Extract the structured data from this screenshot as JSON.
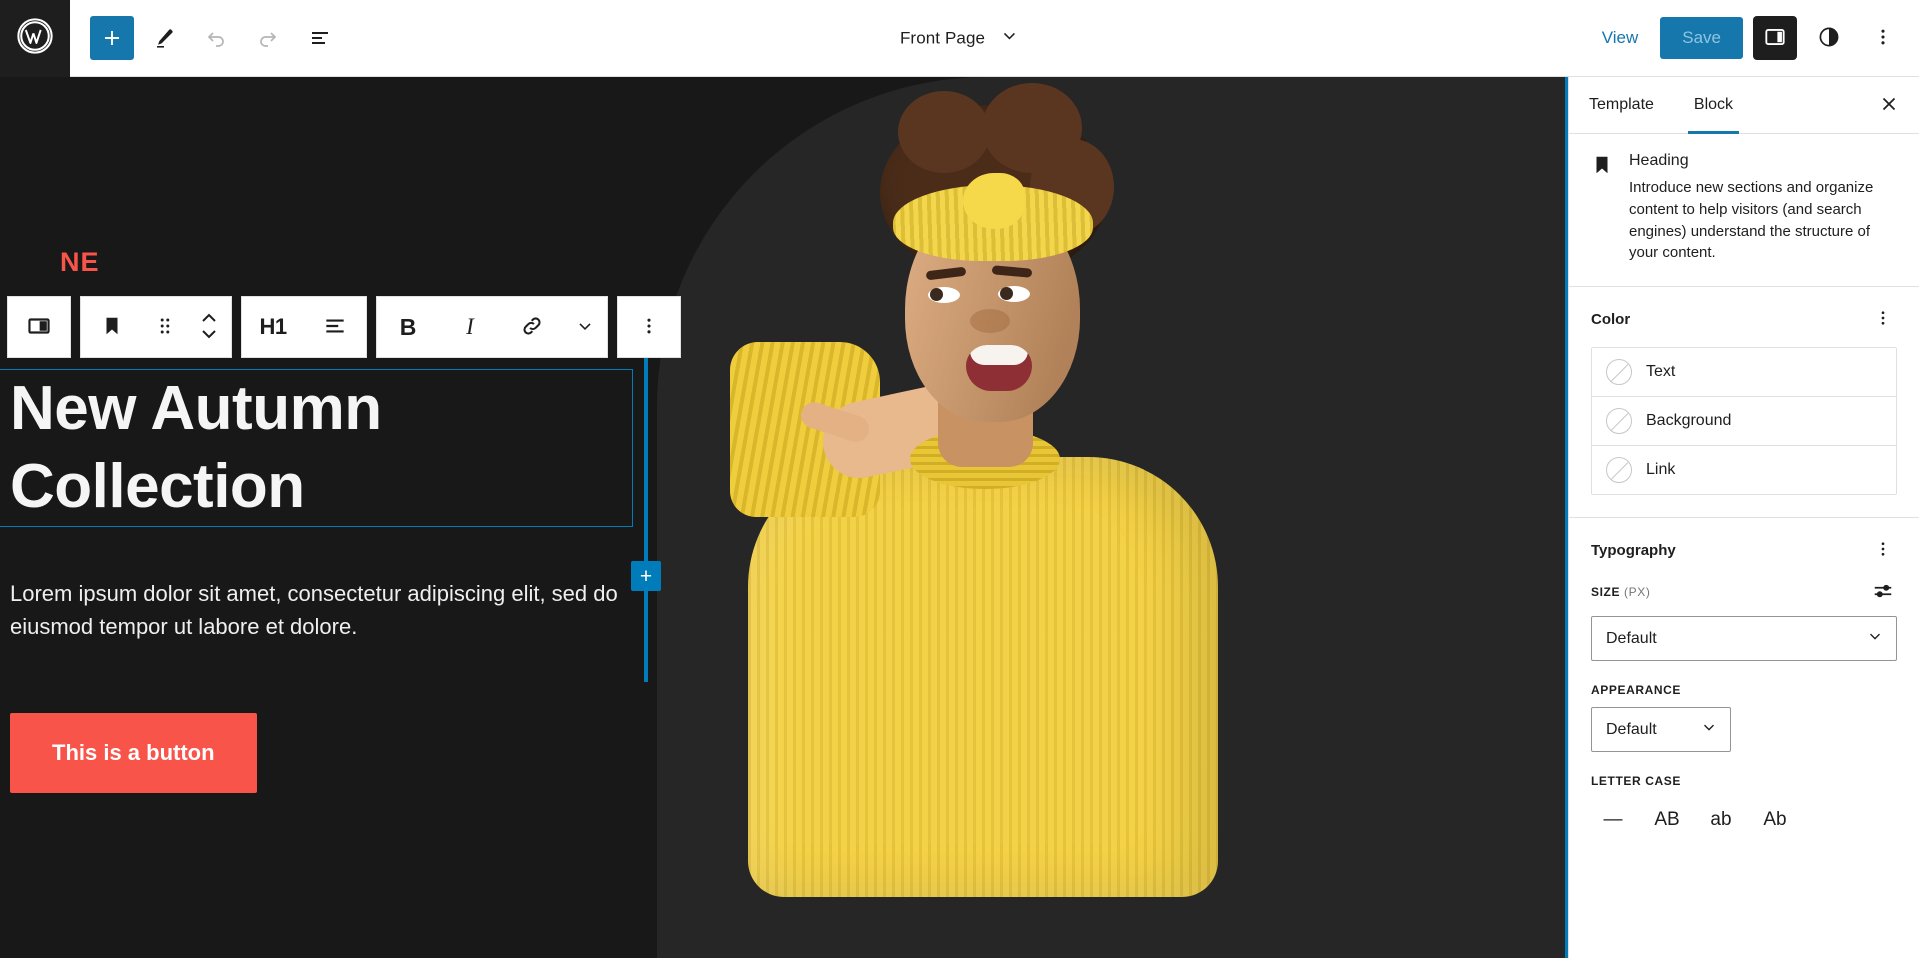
{
  "header": {
    "logo_icon": "wordpress-logo",
    "tools": [
      {
        "name": "add-block",
        "icon": "plus-icon",
        "label": "Add block"
      },
      {
        "name": "edit-mode",
        "icon": "pencil-icon",
        "label": "Edit"
      },
      {
        "name": "undo",
        "icon": "undo-arrow-icon",
        "label": "Undo"
      },
      {
        "name": "redo",
        "icon": "redo-arrow-icon",
        "label": "Redo"
      },
      {
        "name": "list-view",
        "icon": "list-view-icon",
        "label": "List View"
      }
    ],
    "document_title": "Front Page",
    "document_chevron_icon": "chevron-down-icon",
    "view_label": "View",
    "save_label": "Save",
    "settings_toggle_icon": "sidebar-panel-icon",
    "styles_icon": "contrast-circle-icon",
    "options_icon": "three-dots-vertical-icon"
  },
  "block_toolbar": {
    "parent_block_icon": "columns-layout-icon",
    "block_type_icon": "heading-bookmark-icon",
    "drag_handle_icon": "drag-dots-icon",
    "movers_icon": "move-up-down-icon",
    "heading_level": "H1",
    "align_icon": "align-text-icon",
    "bold_label": "B",
    "italic_label": "I",
    "link_icon": "link-icon",
    "more_rich_text_icon": "chevron-down-icon",
    "options_icon": "three-dots-vertical-icon"
  },
  "canvas": {
    "promo_tag": "NE",
    "heading": "New Autumn Collection",
    "paragraph": "Lorem ipsum dolor sit amet, consectetur adipiscing elit, sed do eiusmod tempor ut labore et dolore.",
    "button_label": "This is a button",
    "inserter_label": "+",
    "colors": {
      "background": "#181818",
      "panel": "#262626",
      "button": "#F8544A",
      "selection": "#007cba",
      "heading_text": "#F5F5F5"
    },
    "image_alt": "Smiling woman in yellow knit sweater and yellow headband pointing to the side"
  },
  "sidebar": {
    "tabs": [
      {
        "label": "Template",
        "active": false
      },
      {
        "label": "Block",
        "active": true
      }
    ],
    "close_icon": "close-x-icon",
    "block_card": {
      "icon": "heading-bookmark-icon",
      "title": "Heading",
      "description": "Introduce new sections and organize content to help visitors (and search engines) understand the structure of your content."
    },
    "color_panel": {
      "title": "Color",
      "options_icon": "three-dots-vertical-icon",
      "rows": [
        {
          "label": "Text",
          "swatch": "none"
        },
        {
          "label": "Background",
          "swatch": "none"
        },
        {
          "label": "Link",
          "swatch": "none"
        }
      ]
    },
    "typography_panel": {
      "title": "Typography",
      "options_icon": "three-dots-vertical-icon",
      "size_label": "SIZE",
      "size_unit": "(PX)",
      "size_toggle_icon": "settings-sliders-icon",
      "size_value": "Default",
      "appearance_label": "APPEARANCE",
      "appearance_value": "Default",
      "letter_case_label": "LETTER CASE",
      "letter_case_options": [
        {
          "name": "none",
          "glyph": "—"
        },
        {
          "name": "uppercase",
          "glyph": "AB"
        },
        {
          "name": "lowercase",
          "glyph": "ab"
        },
        {
          "name": "capitalize",
          "glyph": "Ab"
        }
      ]
    }
  }
}
